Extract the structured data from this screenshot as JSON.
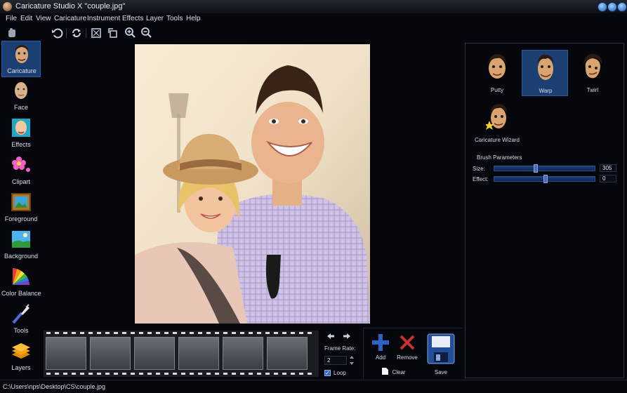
{
  "window": {
    "title": "Caricature Studio X  \"couple.jpg\""
  },
  "menu": [
    "File",
    "Edit",
    "View",
    "Caricature",
    "Instrument",
    "Effects",
    "Layer",
    "Tools",
    "Help"
  ],
  "toolbar": {
    "icons": [
      "pan-icon",
      "undo-icon",
      "reset-icon",
      "crop-icon",
      "rotate-icon",
      "zoom-in-icon",
      "zoom-out-icon"
    ]
  },
  "sidebar": {
    "items": [
      {
        "label": "Caricature",
        "icon": "caricature-face-icon"
      },
      {
        "label": "Face",
        "icon": "face-icon"
      },
      {
        "label": "Effects",
        "icon": "effects-icon"
      },
      {
        "label": "Clipart",
        "icon": "clipart-icon"
      },
      {
        "label": "Foreground",
        "icon": "foreground-icon"
      },
      {
        "label": "Background",
        "icon": "background-icon"
      },
      {
        "label": "Color Balance",
        "icon": "color-balance-icon"
      },
      {
        "label": "Tools",
        "icon": "tools-icon"
      },
      {
        "label": "Layers",
        "icon": "layers-icon"
      }
    ],
    "active": "Caricature"
  },
  "tools": {
    "items": [
      {
        "label": "Putty",
        "icon": "putty-face-icon"
      },
      {
        "label": "Warp",
        "icon": "warp-face-icon"
      },
      {
        "label": "Twirl",
        "icon": "twirl-face-icon"
      },
      {
        "label": "Caricature Wizard",
        "icon": "wizard-face-icon"
      }
    ],
    "active": "Warp"
  },
  "brush": {
    "title": "Brush Parameters",
    "size_label": "Size:",
    "size_value": "305",
    "size_fraction": 0.4,
    "effect_label": "Effect:",
    "effect_value": "0",
    "effect_fraction": 0.5
  },
  "frames": {
    "frame_rate_label": "Frame Rate:",
    "frame_rate_value": "2",
    "loop_label": "Loop",
    "loop_checked": true,
    "add_label": "Add",
    "remove_label": "Remove",
    "clear_label": "Clear",
    "save_label": "Save"
  },
  "status": {
    "path": "C:\\Users\\nps\\Desktop\\CS\\couple.jpg"
  },
  "colors": {
    "accent": "#1c3f73",
    "background": "#05070d"
  }
}
